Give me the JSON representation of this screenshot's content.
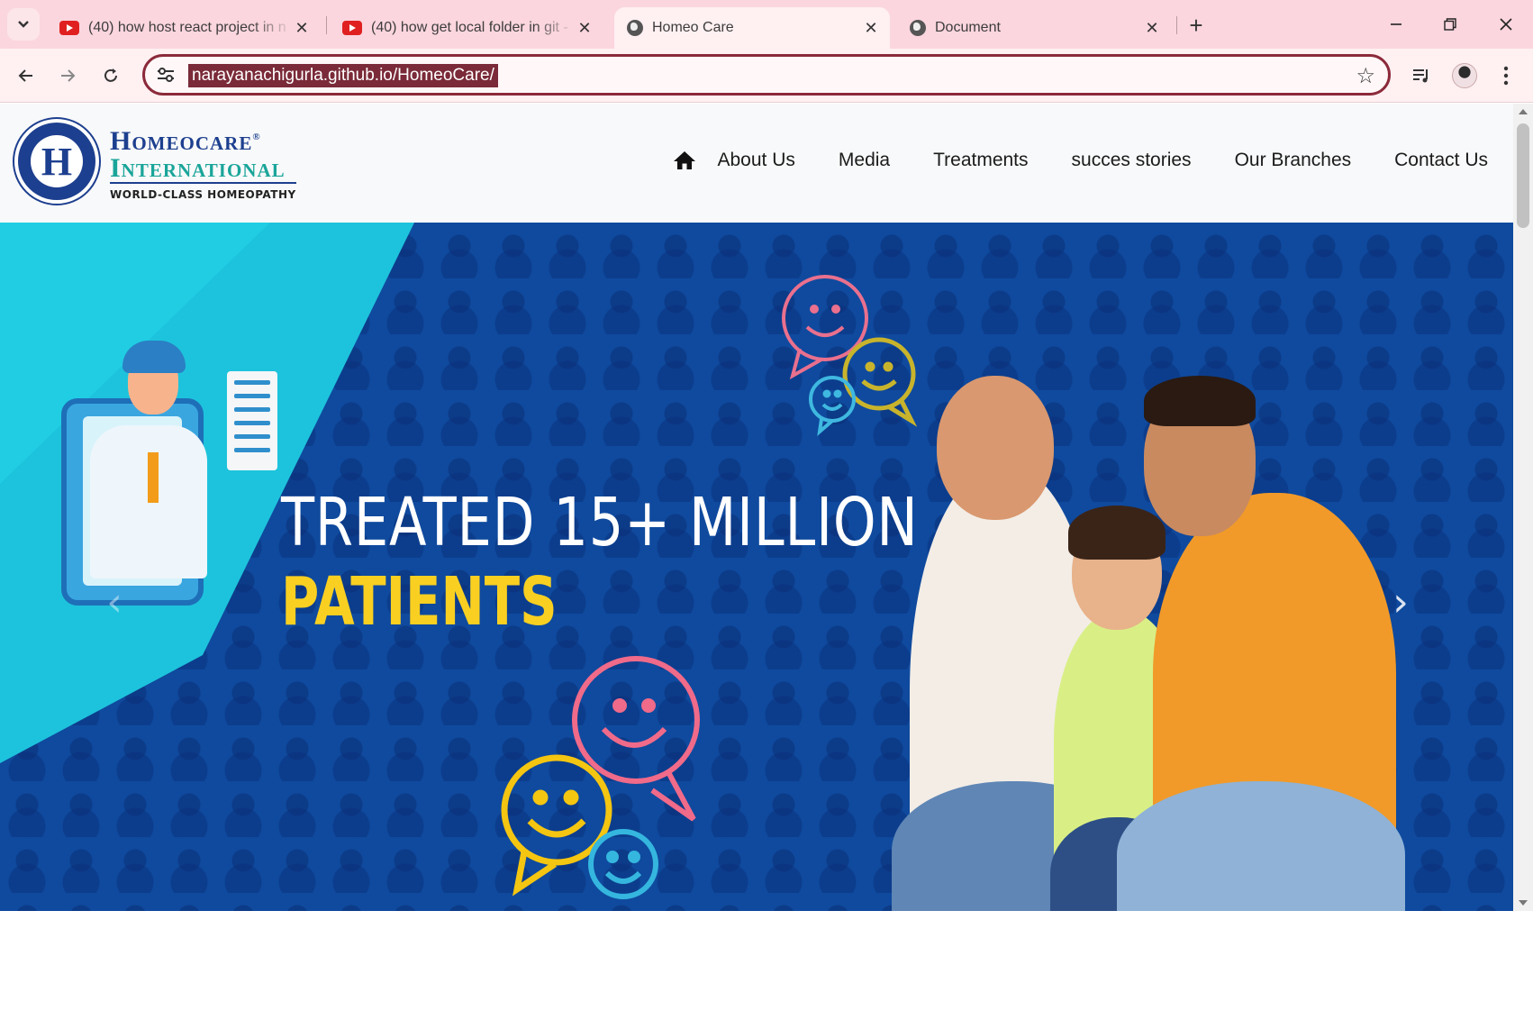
{
  "browser": {
    "tabs": [
      {
        "title": "(40) how host react project in n",
        "icon": "youtube-icon"
      },
      {
        "title": "(40) how get local folder in git -",
        "icon": "youtube-icon"
      },
      {
        "title": "Homeo Care",
        "icon": "globe-icon",
        "active": true
      },
      {
        "title": "Document",
        "icon": "globe-icon"
      }
    ],
    "new_tab": "+",
    "close_glyph": "✕",
    "window_controls": {
      "minimize": "—",
      "restore": "❐",
      "close": "✕"
    },
    "url": "narayanachigurla.github.io/HomeoCare/",
    "accent": "#8b2a3a"
  },
  "site": {
    "logo": {
      "line1": "Homeocare",
      "line2": "International",
      "tagline": "WORLD-CLASS HOMEOPATHY",
      "seal_letter": "H",
      "registered": "®"
    },
    "nav": {
      "home_icon": "home-icon",
      "items": [
        "About Us",
        "Media",
        "Treatments",
        "succes stories",
        "Our Branches",
        "Contact Us"
      ]
    },
    "hero": {
      "headline_line1": "TREATED 15+ MILLION",
      "headline_line2": "PATIENTS",
      "prev": "‹",
      "next": "›",
      "colors": {
        "background": "#0f4a9e",
        "panel": "#1dc3dc",
        "highlight": "#f9d021"
      }
    }
  }
}
